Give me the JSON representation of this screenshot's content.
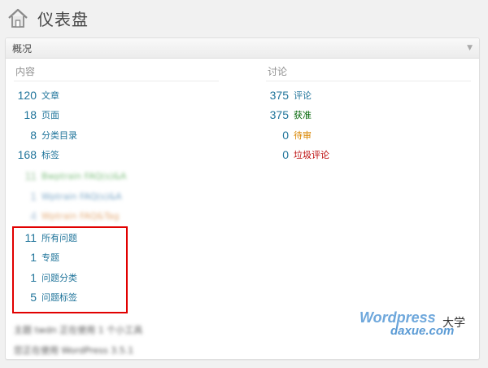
{
  "header": {
    "title": "仪表盘"
  },
  "panel": {
    "title": "概况"
  },
  "content_col": {
    "heading": "内容",
    "items": [
      {
        "count": "120",
        "label": "文章"
      },
      {
        "count": "18",
        "label": "页面"
      },
      {
        "count": "8",
        "label": "分类目录"
      },
      {
        "count": "168",
        "label": "标签"
      }
    ],
    "blurred_items": [
      {
        "count": "11",
        "label": "Bwptrain FAQ(s)&A"
      },
      {
        "count": "1",
        "label": "Wptrain FAQ(s)&A"
      },
      {
        "count": "4",
        "label": "Wptrain FAQ&Tag"
      }
    ],
    "highlighted_items": [
      {
        "count": "11",
        "label": "所有问题"
      },
      {
        "count": "1",
        "label": "专题"
      },
      {
        "count": "1",
        "label": "问题分类"
      },
      {
        "count": "5",
        "label": "问题标签"
      }
    ]
  },
  "discussion_col": {
    "heading": "讨论",
    "items": [
      {
        "count": "375",
        "label": "评论",
        "color": "#21759b"
      },
      {
        "count": "375",
        "label": "获准",
        "color": "#006505"
      },
      {
        "count": "0",
        "label": "待审",
        "color": "#d98500"
      },
      {
        "count": "0",
        "label": "垃圾评论",
        "color": "#bc0b0b"
      }
    ]
  },
  "footer": {
    "line1": "主题 twdn 正在使用 1 个小工具",
    "line2": "您正在使用 WordPress 3.5.1"
  },
  "watermark": {
    "line1": "Wordpress",
    "line2": "daxue.com",
    "line3": "大学"
  }
}
